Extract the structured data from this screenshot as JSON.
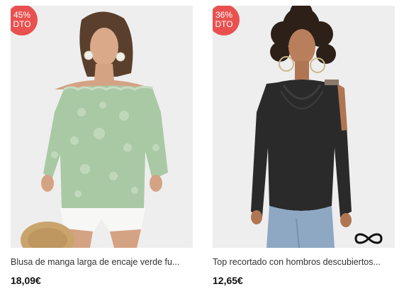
{
  "products": [
    {
      "discount": "45%",
      "discount_suffix": "DTO",
      "title": "Blusa de manga larga de encaje verde fu...",
      "price": "18,09€"
    },
    {
      "discount": "36%",
      "discount_suffix": "DTO",
      "title": "Top recortado con hombros descubiertos...",
      "price": "12,65€"
    }
  ],
  "colors": {
    "badge": "#e8514f",
    "lace_top": "#a9c9a4",
    "black_top": "#2a2a2a"
  },
  "icons": [
    "infinity-logo-icon"
  ]
}
